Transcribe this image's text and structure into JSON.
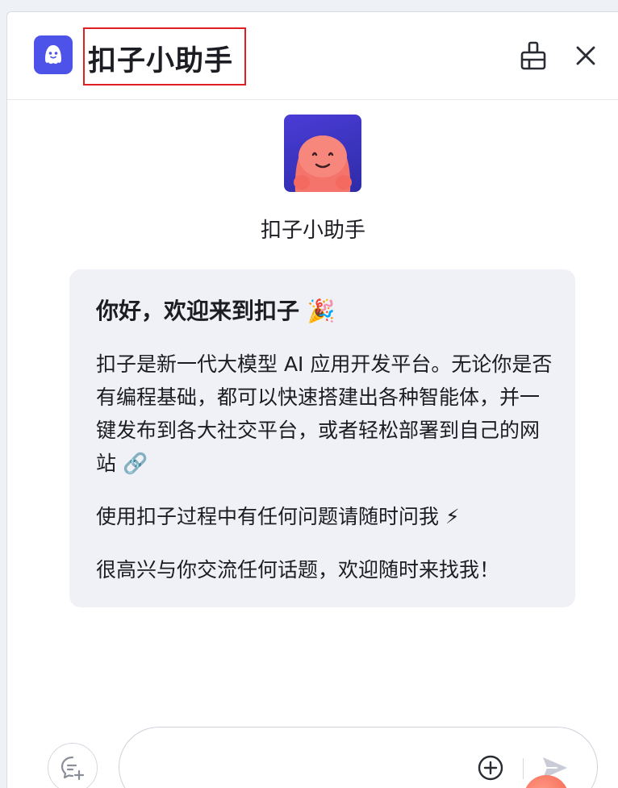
{
  "header": {
    "title": "扣子小助手",
    "logo_icon": "coze-ghost-icon",
    "clean_icon": "broom-icon",
    "close_icon": "close-icon"
  },
  "bot": {
    "name": "扣子小助手",
    "avatar_icon": "pink-ghost-avatar"
  },
  "message": {
    "greeting": "你好，欢迎来到扣子 🎉",
    "paragraphs": [
      "扣子是新一代大模型 AI 应用开发平台。无论你是否有编程基础，都可以快速搭建出各种智能体，并一键发布到各大社交平台，或者轻松部署到自己的网站 🔗",
      "使用扣子过程中有任何问题请随时问我 ⚡",
      "很高兴与你交流任何话题，欢迎随时来找我！"
    ]
  },
  "composer": {
    "placeholder": "",
    "new_chat_icon": "new-chat-icon",
    "add_icon": "plus-circle-icon",
    "send_icon": "send-icon"
  },
  "colors": {
    "brand": "#4d53e8",
    "bubble_bg": "#f0f1f6",
    "highlight_border": "#e02020"
  }
}
